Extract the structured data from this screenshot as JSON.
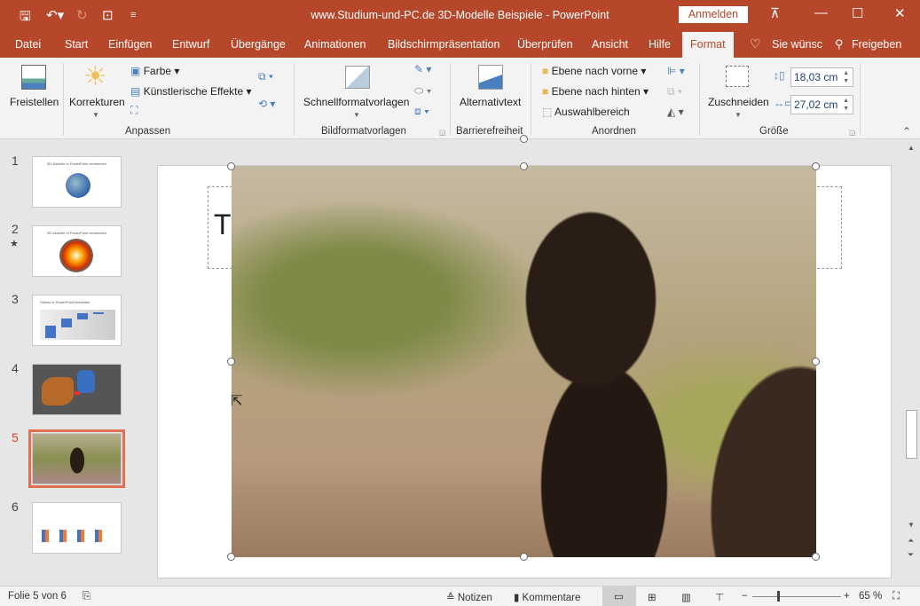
{
  "window": {
    "title": "www.Studium-und-PC.de  3D-Modelle Beispiele  -  PowerPoint",
    "signin": "Anmelden"
  },
  "tabs": [
    "Datei",
    "Start",
    "Einfügen",
    "Entwurf",
    "Übergänge",
    "Animationen",
    "Bildschirmpräsentation",
    "Überprüfen",
    "Ansicht",
    "Hilfe",
    "Format"
  ],
  "tell_me": "Sie wünsc",
  "share": "Freigeben",
  "ribbon": {
    "freistellen": "Freistellen",
    "korrekturen": "Korrekturen",
    "farbe": "Farbe",
    "kuenstlerisch": "Künstlerische Effekte",
    "anpassen": "Anpassen",
    "schnellformat": "Schnellformatvorlagen",
    "bildformatvorlagen": "Bildformatvorlagen",
    "alternativtext": "Alternativtext",
    "barrierefreiheit": "Barrierefreiheit",
    "ebene_vorne": "Ebene nach vorne",
    "ebene_hinten": "Ebene nach hinten",
    "auswahlbereich": "Auswahlbereich",
    "anordnen": "Anordnen",
    "zuschneiden": "Zuschneiden",
    "hoehe": "18,03 cm",
    "breite": "27,02 cm",
    "groesse": "Größe"
  },
  "slides": [
    {
      "num": "1",
      "title": "3D-Modelle in PowerPoint verwenden"
    },
    {
      "num": "2",
      "title": "3D-Modelle in PowerPoint verwenden",
      "star": "★"
    },
    {
      "num": "3",
      "title": "Videos in PowerPoint einbinden"
    },
    {
      "num": "4",
      "title": ""
    },
    {
      "num": "5",
      "title": ""
    },
    {
      "num": "6",
      "title": ""
    }
  ],
  "slide_title_fragment": "T",
  "status": {
    "slide": "Folie 5 von 6",
    "notes": "Notizen",
    "comments": "Kommentare",
    "zoom": "65 %"
  },
  "colors": {
    "accent": "#b7472a",
    "selected": "#e07050"
  }
}
